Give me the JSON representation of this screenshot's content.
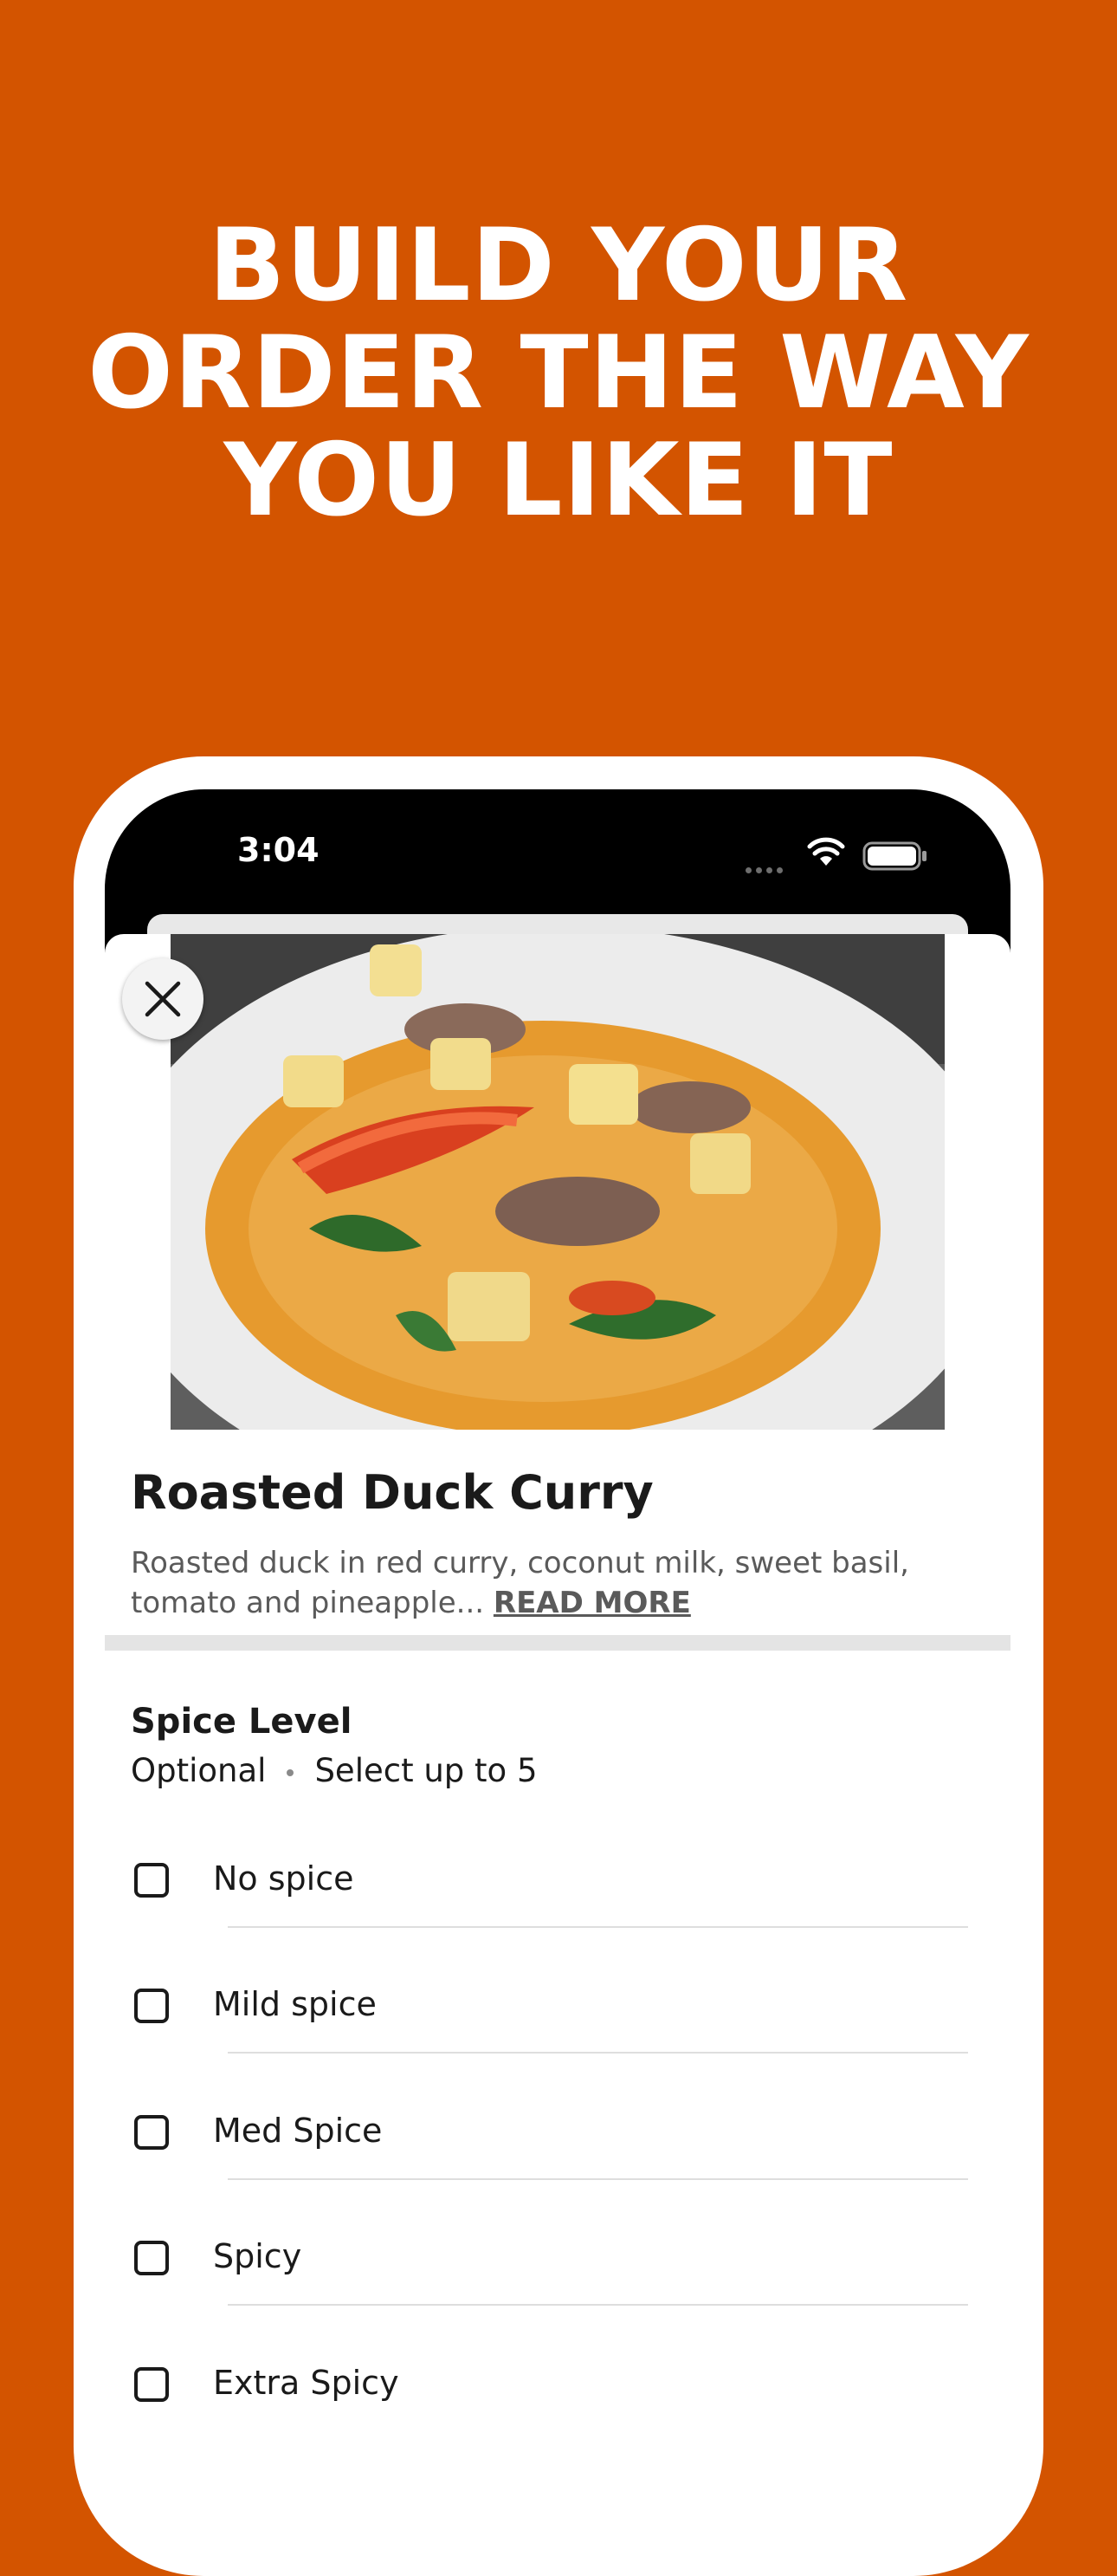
{
  "colors": {
    "background": "#d35400",
    "headline": "#ffffff",
    "text_primary": "#1a1a1a",
    "text_secondary": "#5a5a5a"
  },
  "headline": {
    "line1": "BUILD YOUR",
    "line2": "ORDER THE WAY",
    "line3": "YOU LIKE IT"
  },
  "status_bar": {
    "time": "3:04",
    "icons": [
      "cellular-dots-icon",
      "wifi-icon",
      "battery-icon"
    ]
  },
  "item": {
    "image_description": "roasted duck curry bowl",
    "title": "Roasted Duck Curry",
    "description": "Roasted duck in red curry, coconut milk, sweet basil, tomato and pineapple... ",
    "read_more": "READ MORE"
  },
  "spice_section": {
    "title": "Spice Level",
    "optional": "Optional",
    "select_limit": "Select up to 5",
    "options": [
      {
        "label": "No spice",
        "checked": false
      },
      {
        "label": "Mild spice",
        "checked": false
      },
      {
        "label": "Med Spice",
        "checked": false
      },
      {
        "label": "Spicy",
        "checked": false
      },
      {
        "label": "Extra Spicy",
        "checked": false
      }
    ]
  }
}
